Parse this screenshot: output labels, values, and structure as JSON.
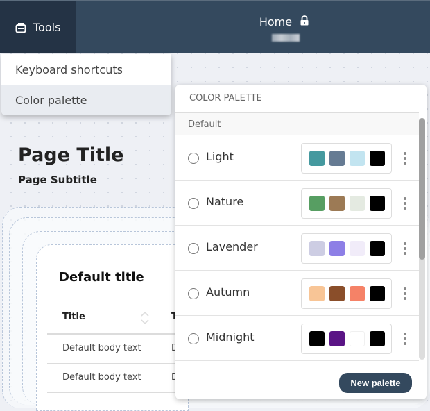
{
  "header": {
    "tools_label": "Tools",
    "title": "Home",
    "lock_icon": "lock-icon",
    "tools_icon": "toolbox-icon"
  },
  "menu": {
    "items": [
      {
        "label": "Keyboard shortcuts"
      },
      {
        "label": "Color palette",
        "selected": true
      }
    ]
  },
  "page": {
    "title": "Page Title",
    "subtitle": "Page Subtitle"
  },
  "card": {
    "title": "Default title",
    "columns": [
      "Title",
      "T"
    ],
    "rows": [
      [
        "Default body text",
        "D"
      ],
      [
        "Default body text",
        "D"
      ]
    ]
  },
  "palette": {
    "heading": "COLOR PALETTE",
    "group": "Default",
    "items": [
      {
        "name": "Light",
        "colors": [
          "#45999f",
          "#667b93",
          "#c2e4f0",
          "#000000"
        ]
      },
      {
        "name": "Nature",
        "colors": [
          "#579e62",
          "#9c7a55",
          "#e4eae1",
          "#000000"
        ]
      },
      {
        "name": "Lavender",
        "colors": [
          "#cdcde3",
          "#8d7fe6",
          "#f1ecf9",
          "#000000"
        ]
      },
      {
        "name": "Autumn",
        "colors": [
          "#f8c596",
          "#8a4e2a",
          "#f58267",
          "#000000"
        ]
      },
      {
        "name": "Midnight",
        "colors": [
          "#000000",
          "#5a1485",
          "#ffffff",
          "#000000"
        ]
      }
    ],
    "new_button": "New palette"
  }
}
